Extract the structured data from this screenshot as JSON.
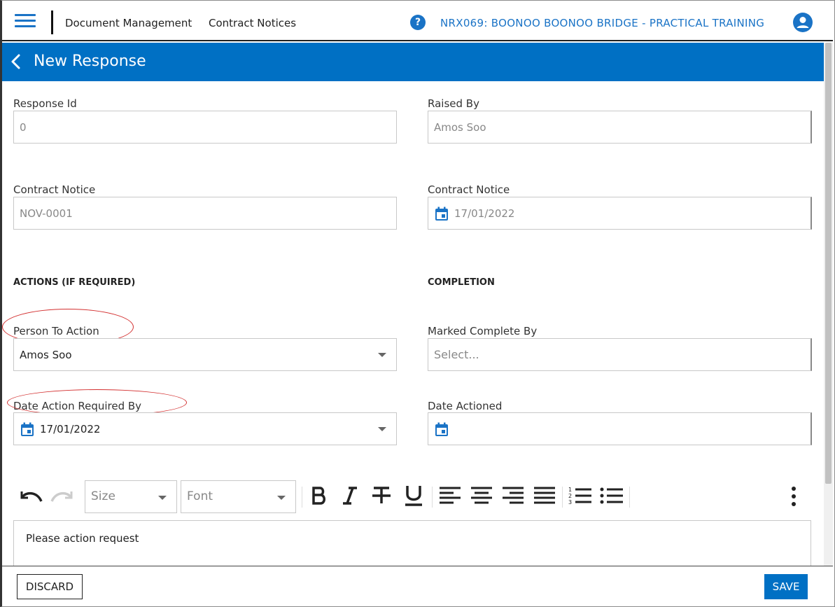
{
  "topnav": {
    "nav_links": [
      "Document Management",
      "Contract Notices"
    ],
    "help_label": "?",
    "project_title": "NRX069: BOONOO BOONOO BRIDGE - PRACTICAL TRAINING"
  },
  "header": {
    "title": "New Response"
  },
  "form": {
    "response_id": {
      "label": "Response Id",
      "value": "0"
    },
    "raised_by": {
      "label": "Raised By",
      "value": "Amos Soo"
    },
    "contract_notice": {
      "label": "Contract Notice",
      "value": "NOV-0001"
    },
    "contract_notice_date": {
      "label": "Contract Notice",
      "value": "17/01/2022"
    },
    "actions_section": "ACTIONS (IF REQUIRED)",
    "completion_section": "COMPLETION",
    "person_to_action": {
      "label": "Person To Action",
      "value": "Amos Soo"
    },
    "marked_complete_by": {
      "label": "Marked Complete By",
      "placeholder": "Select..."
    },
    "date_action_required_by": {
      "label": "Date Action Required By",
      "value": "17/01/2022"
    },
    "date_actioned": {
      "label": "Date Actioned",
      "value": ""
    }
  },
  "editor": {
    "size_placeholder": "Size",
    "font_placeholder": "Font",
    "content": "Please action request"
  },
  "footer": {
    "discard_label": "DISCARD",
    "save_label": "SAVE"
  },
  "colors": {
    "accent": "#0070c4",
    "link": "#1a73c6",
    "annotation": "#d32f2f"
  },
  "icons": [
    "hamburger-icon",
    "help-icon",
    "user-icon",
    "back-icon",
    "calendar-icon",
    "undo-icon",
    "redo-icon",
    "bold-icon",
    "italic-icon",
    "strikethrough-icon",
    "underline-icon",
    "align-left-icon",
    "align-center-icon",
    "align-right-icon",
    "align-justify-icon",
    "ordered-list-icon",
    "unordered-list-icon",
    "more-vertical-icon"
  ]
}
